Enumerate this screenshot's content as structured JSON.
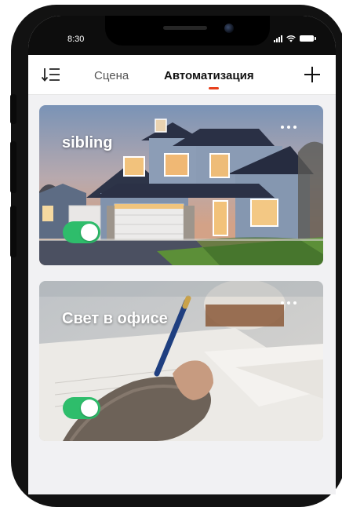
{
  "status_bar": {
    "time": "8:30"
  },
  "header": {
    "tabs": [
      {
        "label": "Сцена",
        "active": false
      },
      {
        "label": "Автоматизация",
        "active": true
      }
    ],
    "sort_icon": "sort-list-icon",
    "add_icon": "plus-icon"
  },
  "colors": {
    "accent": "#e8401c",
    "toggle_on": "#2ebd6b",
    "background": "#f1f1f3"
  },
  "automations": [
    {
      "title": "sibling",
      "enabled": true,
      "image": "house-photo",
      "menu_icon": "more-dots-icon"
    },
    {
      "title": "Свет в офисе",
      "enabled": true,
      "image": "office-writing-photo",
      "menu_icon": "more-dots-icon"
    }
  ]
}
